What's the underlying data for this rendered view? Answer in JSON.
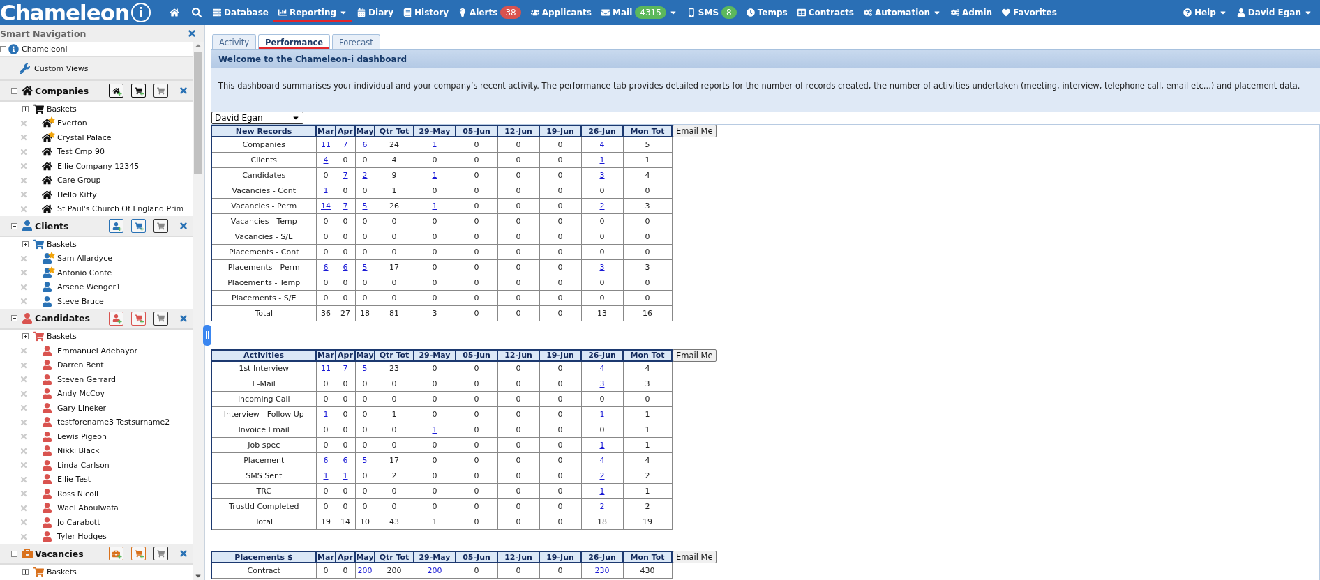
{
  "logo": {
    "text": "Chameleon",
    "mark": "i"
  },
  "nav": [
    {
      "label": "Database",
      "selected": false,
      "menu": false
    },
    {
      "label": "Reporting",
      "selected": true,
      "menu": true
    },
    {
      "label": "Diary",
      "selected": false,
      "menu": false
    },
    {
      "label": "History",
      "selected": false,
      "menu": false
    },
    {
      "label": "Alerts",
      "selected": false,
      "menu": false,
      "badge": "38",
      "color": "#d9534f"
    },
    {
      "label": "Applicants",
      "selected": false,
      "menu": false
    },
    {
      "label": "Mail",
      "selected": false,
      "menu": true,
      "badge": "4315",
      "color": "#5cb85c"
    },
    {
      "label": "SMS",
      "selected": false,
      "menu": false,
      "badge": "8",
      "color": "#5cb85c"
    },
    {
      "label": "Temps",
      "selected": false,
      "menu": false
    },
    {
      "label": "Contracts",
      "selected": false,
      "menu": false
    },
    {
      "label": "Automation",
      "selected": false,
      "menu": true
    },
    {
      "label": "Admin",
      "selected": false,
      "menu": false
    },
    {
      "label": "Favorites",
      "selected": false,
      "menu": false
    }
  ],
  "nav_right": [
    {
      "label": "Help",
      "menu": true
    },
    {
      "label": "David Egan",
      "menu": true
    }
  ],
  "sidebar": {
    "title": "Smart Navigation",
    "root": {
      "label": "Chameleoni",
      "expanded": true
    },
    "custom_views": "Custom Views",
    "sections": [
      {
        "label": "Companies",
        "kind": "company",
        "color": "#111111",
        "expanded": true,
        "baskets": {
          "label": "Baskets",
          "expanded": false
        },
        "children": [
          {
            "label": "Everton",
            "starred": true
          },
          {
            "label": "Crystal Palace",
            "starred": true
          },
          {
            "label": "Test Cmp 90",
            "starred": false
          },
          {
            "label": "Ellie Company 12345",
            "starred": false
          },
          {
            "label": "Care Group",
            "starred": false
          },
          {
            "label": "Hello Kitty",
            "starred": false
          },
          {
            "label": "St Paul's Church Of England Prim",
            "starred": false
          }
        ]
      },
      {
        "label": "Clients",
        "kind": "client",
        "color": "#2a72b5",
        "expanded": true,
        "baskets": {
          "label": "Baskets",
          "expanded": false
        },
        "children": [
          {
            "label": "Sam Allardyce",
            "starred": true
          },
          {
            "label": "Antonio Conte",
            "starred": true
          },
          {
            "label": "Arsene Wenger1",
            "starred": false
          },
          {
            "label": "Steve Bruce",
            "starred": false
          }
        ]
      },
      {
        "label": "Candidates",
        "kind": "candidate",
        "color": "#d9534f",
        "expanded": true,
        "baskets": {
          "label": "Baskets",
          "expanded": false
        },
        "children": [
          {
            "label": "Emmanuel Adebayor",
            "starred": false
          },
          {
            "label": "Darren Bent",
            "starred": false
          },
          {
            "label": "Steven Gerrard",
            "starred": false
          },
          {
            "label": "Andy McCoy",
            "starred": false
          },
          {
            "label": "Gary Lineker",
            "starred": false
          },
          {
            "label": "testforename3 Testsurname2",
            "starred": false
          },
          {
            "label": "Lewis Pigeon",
            "starred": false
          },
          {
            "label": "Nikki Black",
            "starred": false
          },
          {
            "label": "Linda Carlson",
            "starred": false
          },
          {
            "label": "Ellie Test",
            "starred": false
          },
          {
            "label": "Ross Nicoll",
            "starred": false
          },
          {
            "label": "Wael Aboulwafa",
            "starred": false
          },
          {
            "label": "Jo Carabott",
            "starred": false
          },
          {
            "label": "Tyler Hodges",
            "starred": false
          }
        ]
      },
      {
        "label": "Vacancies",
        "kind": "vacancy",
        "color": "#d9711c",
        "expanded": true,
        "baskets": {
          "label": "Baskets",
          "expanded": false
        }
      }
    ]
  },
  "tabs": [
    {
      "label": "Activity",
      "selected": false
    },
    {
      "label": "Performance",
      "selected": true
    },
    {
      "label": "Forecast",
      "selected": false
    }
  ],
  "panel": {
    "title": "Welcome to the Chameleon-i dashboard",
    "description": "This dashboard summarises your individual and your company’s recent activity. The performance tab provides detailed reports for the number of records created, the number of activities undertaken (meeting, interview, telephone call, email etc...) and placement data.",
    "user_select": "David Egan"
  },
  "tables": [
    {
      "title": "New Records",
      "columns": [
        "Mar",
        "Apr",
        "May",
        "Qtr Tot",
        "29-May",
        "05-Jun",
        "12-Jun",
        "19-Jun",
        "26-Jun",
        "Mon Tot"
      ],
      "button": "Email Me",
      "rows": [
        {
          "label": "Companies",
          "values": [
            "11",
            "7",
            "6",
            "24",
            "1",
            "0",
            "0",
            "0",
            "4",
            "5"
          ],
          "links": [
            true,
            true,
            true,
            false,
            true,
            false,
            false,
            false,
            true,
            false
          ]
        },
        {
          "label": "Clients",
          "values": [
            "4",
            "0",
            "0",
            "4",
            "0",
            "0",
            "0",
            "0",
            "1",
            "1"
          ],
          "links": [
            true,
            false,
            false,
            false,
            false,
            false,
            false,
            false,
            true,
            false
          ]
        },
        {
          "label": "Candidates",
          "values": [
            "0",
            "7",
            "2",
            "9",
            "1",
            "0",
            "0",
            "0",
            "3",
            "4"
          ],
          "links": [
            false,
            true,
            true,
            false,
            true,
            false,
            false,
            false,
            true,
            false
          ]
        },
        {
          "label": "Vacancies - Cont",
          "values": [
            "1",
            "0",
            "0",
            "1",
            "0",
            "0",
            "0",
            "0",
            "0",
            "0"
          ],
          "links": [
            true,
            false,
            false,
            false,
            false,
            false,
            false,
            false,
            false,
            false
          ]
        },
        {
          "label": "Vacancies - Perm",
          "values": [
            "14",
            "7",
            "5",
            "26",
            "1",
            "0",
            "0",
            "0",
            "2",
            "3"
          ],
          "links": [
            true,
            true,
            true,
            false,
            true,
            false,
            false,
            false,
            true,
            false
          ]
        },
        {
          "label": "Vacancies - Temp",
          "values": [
            "0",
            "0",
            "0",
            "0",
            "0",
            "0",
            "0",
            "0",
            "0",
            "0"
          ],
          "links": [
            false,
            false,
            false,
            false,
            false,
            false,
            false,
            false,
            false,
            false
          ]
        },
        {
          "label": "Vacancies - S/E",
          "values": [
            "0",
            "0",
            "0",
            "0",
            "0",
            "0",
            "0",
            "0",
            "0",
            "0"
          ],
          "links": [
            false,
            false,
            false,
            false,
            false,
            false,
            false,
            false,
            false,
            false
          ]
        },
        {
          "label": "Placements - Cont",
          "values": [
            "0",
            "0",
            "0",
            "0",
            "0",
            "0",
            "0",
            "0",
            "0",
            "0"
          ],
          "links": [
            false,
            false,
            false,
            false,
            false,
            false,
            false,
            false,
            false,
            false
          ]
        },
        {
          "label": "Placements - Perm",
          "values": [
            "6",
            "6",
            "5",
            "17",
            "0",
            "0",
            "0",
            "0",
            "3",
            "3"
          ],
          "links": [
            true,
            true,
            true,
            false,
            false,
            false,
            false,
            false,
            true,
            false
          ]
        },
        {
          "label": "Placements - Temp",
          "values": [
            "0",
            "0",
            "0",
            "0",
            "0",
            "0",
            "0",
            "0",
            "0",
            "0"
          ],
          "links": [
            false,
            false,
            false,
            false,
            false,
            false,
            false,
            false,
            false,
            false
          ]
        },
        {
          "label": "Placements - S/E",
          "values": [
            "0",
            "0",
            "0",
            "0",
            "0",
            "0",
            "0",
            "0",
            "0",
            "0"
          ],
          "links": [
            false,
            false,
            false,
            false,
            false,
            false,
            false,
            false,
            false,
            false
          ]
        },
        {
          "label": "Total",
          "values": [
            "36",
            "27",
            "18",
            "81",
            "3",
            "0",
            "0",
            "0",
            "13",
            "16"
          ],
          "links": [
            false,
            false,
            false,
            false,
            false,
            false,
            false,
            false,
            false,
            false
          ]
        }
      ]
    },
    {
      "title": "Activities",
      "columns": [
        "Mar",
        "Apr",
        "May",
        "Qtr Tot",
        "29-May",
        "05-Jun",
        "12-Jun",
        "19-Jun",
        "26-Jun",
        "Mon Tot"
      ],
      "button": "Email Me",
      "rows": [
        {
          "label": "1st Interview",
          "values": [
            "11",
            "7",
            "5",
            "23",
            "0",
            "0",
            "0",
            "0",
            "4",
            "4"
          ],
          "links": [
            true,
            true,
            true,
            false,
            false,
            false,
            false,
            false,
            true,
            false
          ]
        },
        {
          "label": "E-Mail",
          "values": [
            "0",
            "0",
            "0",
            "0",
            "0",
            "0",
            "0",
            "0",
            "3",
            "3"
          ],
          "links": [
            false,
            false,
            false,
            false,
            false,
            false,
            false,
            false,
            true,
            false
          ]
        },
        {
          "label": "Incoming Call",
          "values": [
            "0",
            "0",
            "0",
            "0",
            "0",
            "0",
            "0",
            "0",
            "0",
            "0"
          ],
          "links": [
            false,
            false,
            false,
            false,
            false,
            false,
            false,
            false,
            false,
            false
          ]
        },
        {
          "label": "Interview - Follow Up",
          "values": [
            "1",
            "0",
            "0",
            "1",
            "0",
            "0",
            "0",
            "0",
            "1",
            "1"
          ],
          "links": [
            true,
            false,
            false,
            false,
            false,
            false,
            false,
            false,
            true,
            false
          ]
        },
        {
          "label": "Invoice Email",
          "values": [
            "0",
            "0",
            "0",
            "0",
            "1",
            "0",
            "0",
            "0",
            "0",
            "1"
          ],
          "links": [
            false,
            false,
            false,
            false,
            true,
            false,
            false,
            false,
            false,
            false
          ]
        },
        {
          "label": "Job spec",
          "values": [
            "0",
            "0",
            "0",
            "0",
            "0",
            "0",
            "0",
            "0",
            "1",
            "1"
          ],
          "links": [
            false,
            false,
            false,
            false,
            false,
            false,
            false,
            false,
            true,
            false
          ]
        },
        {
          "label": "Placement",
          "values": [
            "6",
            "6",
            "5",
            "17",
            "0",
            "0",
            "0",
            "0",
            "4",
            "4"
          ],
          "links": [
            true,
            true,
            true,
            false,
            false,
            false,
            false,
            false,
            true,
            false
          ]
        },
        {
          "label": "SMS Sent",
          "values": [
            "1",
            "1",
            "0",
            "2",
            "0",
            "0",
            "0",
            "0",
            "2",
            "2"
          ],
          "links": [
            true,
            true,
            false,
            false,
            false,
            false,
            false,
            false,
            true,
            false
          ]
        },
        {
          "label": "TRC",
          "values": [
            "0",
            "0",
            "0",
            "0",
            "0",
            "0",
            "0",
            "0",
            "1",
            "1"
          ],
          "links": [
            false,
            false,
            false,
            false,
            false,
            false,
            false,
            false,
            true,
            false
          ]
        },
        {
          "label": "TrustId Completed",
          "values": [
            "0",
            "0",
            "0",
            "0",
            "0",
            "0",
            "0",
            "0",
            "2",
            "2"
          ],
          "links": [
            false,
            false,
            false,
            false,
            false,
            false,
            false,
            false,
            true,
            false
          ]
        },
        {
          "label": "Total",
          "values": [
            "19",
            "14",
            "10",
            "43",
            "1",
            "0",
            "0",
            "0",
            "18",
            "19"
          ],
          "links": [
            false,
            false,
            false,
            false,
            false,
            false,
            false,
            false,
            false,
            false
          ]
        }
      ]
    },
    {
      "title": "Placements $",
      "columns": [
        "Mar",
        "Apr",
        "May",
        "Qtr Tot",
        "29-May",
        "05-Jun",
        "12-Jun",
        "19-Jun",
        "26-Jun",
        "Mon Tot"
      ],
      "button": "Email Me",
      "rows": [
        {
          "label": "Contract",
          "values": [
            "0",
            "0",
            "200",
            "200",
            "200",
            "0",
            "0",
            "0",
            "230",
            "430"
          ],
          "links": [
            false,
            false,
            true,
            false,
            true,
            false,
            false,
            false,
            true,
            false
          ]
        }
      ]
    }
  ]
}
